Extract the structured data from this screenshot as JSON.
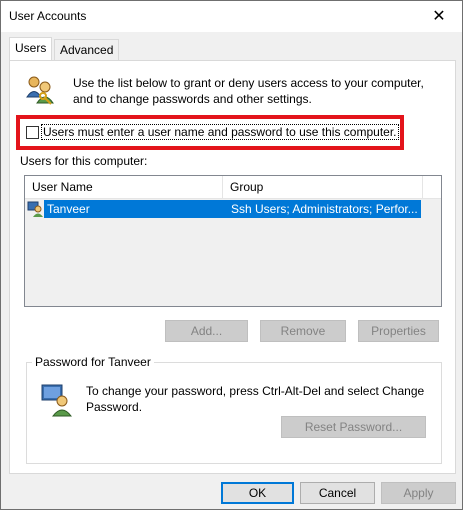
{
  "window": {
    "title": "User Accounts",
    "close_glyph": "✕"
  },
  "tabs": [
    {
      "label": "Users",
      "active": true
    },
    {
      "label": "Advanced",
      "active": false
    }
  ],
  "intro": {
    "text": "Use the list below to grant or deny users access to your computer, and to change passwords and other settings.",
    "icon": "users-icon"
  },
  "checkbox": {
    "label": "Users must enter a user name and password to use this computer.",
    "checked": false
  },
  "users_section": {
    "label": "Users for this computer:"
  },
  "list": {
    "columns": [
      "User Name",
      "Group"
    ],
    "rows": [
      {
        "name": "Tanveer",
        "group": "Ssh Users; Administrators; Perfor...",
        "selected": true
      }
    ]
  },
  "list_buttons": {
    "add": "Add...",
    "remove": "Remove",
    "properties": "Properties"
  },
  "password_group": {
    "label": "Password for Tanveer",
    "text": "To change your password, press Ctrl-Alt-Del and select Change Password.",
    "reset_button": "Reset Password..."
  },
  "dialog_buttons": {
    "ok": "OK",
    "cancel": "Cancel",
    "apply": "Apply"
  },
  "colors": {
    "selection": "#0078d7",
    "highlight_border": "#e3141b"
  }
}
